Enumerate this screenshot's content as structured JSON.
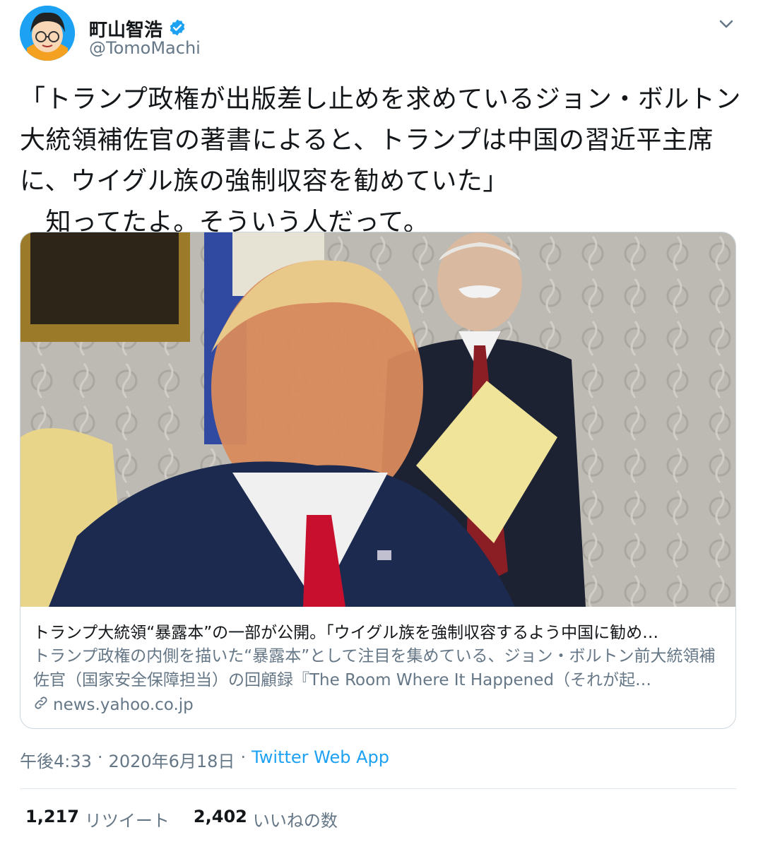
{
  "author": {
    "display_name": "町山智浩",
    "handle": "@TomoMachi",
    "verified_icon": "verified-badge-icon",
    "avatar": "cartoon-avatar"
  },
  "tweet": {
    "text": "「トランプ政権が出版差し止めを求めているジョン・ボルトン大統領補佐官の著書によると、トランプは中国の習近平主席に、ウイグル族の強制収容を勧めていた」\n　知ってたよ。そういう人だって。"
  },
  "card": {
    "image_alt": "photo",
    "title": "トランプ大統領“暴露本”の一部が公開。「ウイグル族を強制収容するよう中国に勧め…",
    "description": "トランプ政権の内側を描いた“暴露本”として注目を集めている、ジョン・ボルトン前大統領補佐官（国家安全保障担当）の回顧録『The Room Where It Happened（それが起…",
    "domain": "news.yahoo.co.jp"
  },
  "meta": {
    "time": "午後4:33",
    "sep1": "·",
    "date": "2020年6月18日",
    "sep2": "·",
    "source": "Twitter Web App"
  },
  "stats": {
    "retweets_count": "1,217",
    "retweets_label": "リツイート",
    "likes_count": "2,402",
    "likes_label": "いいねの数"
  },
  "colors": {
    "accent": "#1da1f2",
    "secondary_text": "#657786",
    "border": "#ccd6dd"
  }
}
